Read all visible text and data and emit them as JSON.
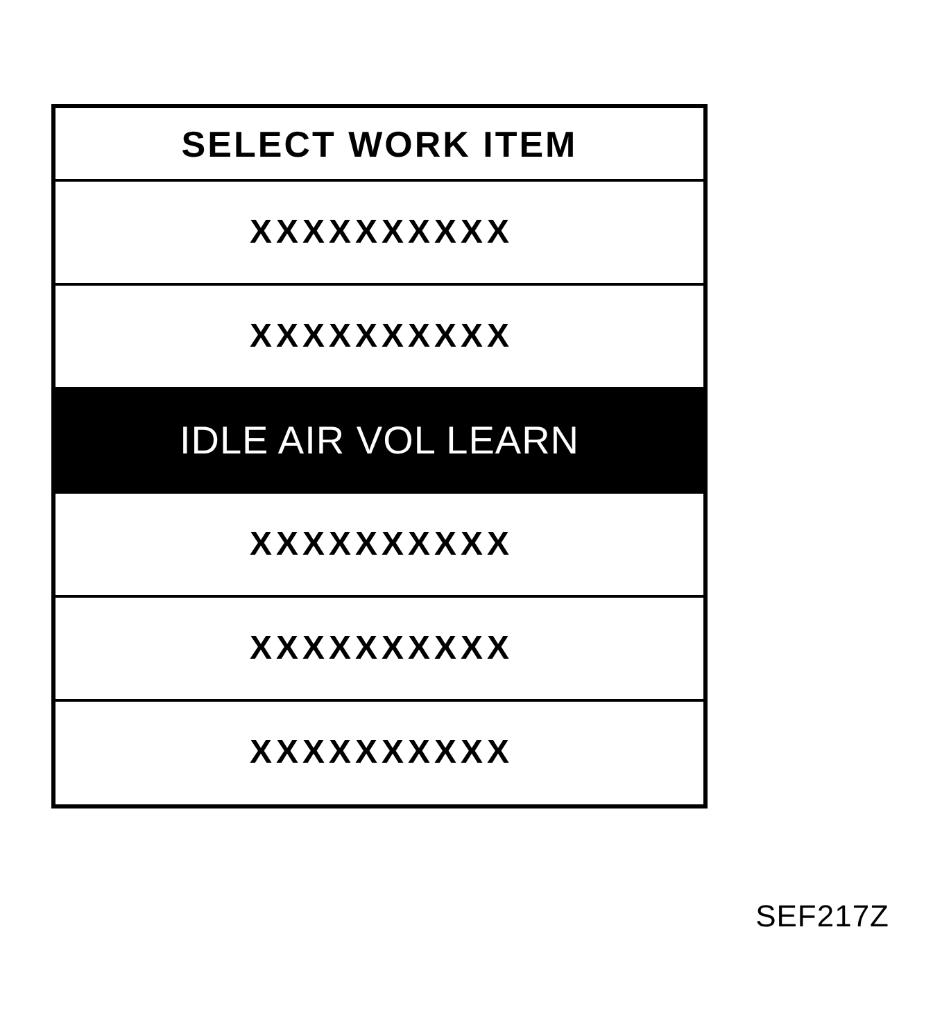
{
  "menu": {
    "title": "SELECT WORK ITEM",
    "items": [
      {
        "label": "XXXXXXXXXX",
        "selected": false
      },
      {
        "label": "XXXXXXXXXX",
        "selected": false
      },
      {
        "label": "IDLE AIR VOL LEARN",
        "selected": true
      },
      {
        "label": "XXXXXXXXXX",
        "selected": false
      },
      {
        "label": "XXXXXXXXXX",
        "selected": false
      },
      {
        "label": "XXXXXXXXXX",
        "selected": false
      }
    ]
  },
  "figure_code": "SEF217Z"
}
